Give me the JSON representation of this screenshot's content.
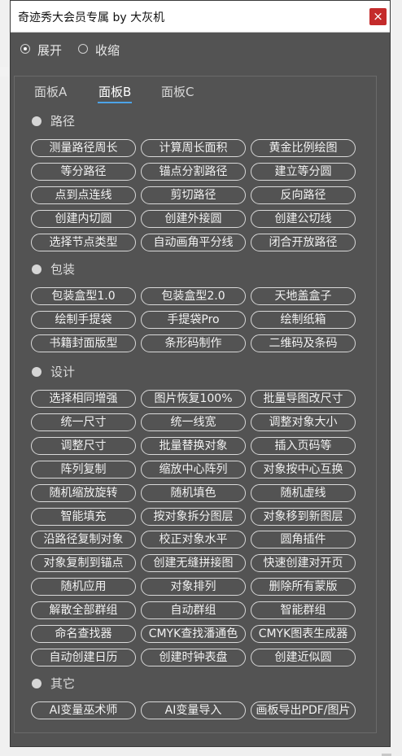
{
  "window": {
    "title": "奇迹秀大会员专属 by 大灰机",
    "close_label": "×"
  },
  "mode": {
    "options": [
      {
        "label": "展开",
        "selected": true
      },
      {
        "label": "收缩",
        "selected": false
      }
    ]
  },
  "tabs": [
    {
      "label": "面板A",
      "active": false
    },
    {
      "label": "面板B",
      "active": true
    },
    {
      "label": "面板C",
      "active": false
    }
  ],
  "sections": [
    {
      "title": "路径",
      "buttons": [
        "测量路径周长",
        "计算周长面积",
        "黄金比例绘图",
        "等分路径",
        "锚点分割路径",
        "建立等分圆",
        "点到点连线",
        "剪切路径",
        "反向路径",
        "创建内切圆",
        "创建外接圆",
        "创建公切线",
        "选择节点类型",
        "自动画角平分线",
        "闭合开放路径"
      ]
    },
    {
      "title": "包装",
      "buttons": [
        "包装盒型1.0",
        "包装盒型2.0",
        "天地盖盒子",
        "绘制手提袋",
        "手提袋Pro",
        "绘制纸箱",
        "书籍封面版型",
        "条形码制作",
        "二维码及条码"
      ]
    },
    {
      "title": "设计",
      "buttons": [
        "选择相同增强",
        "图片恢复100%",
        "批量导图改尺寸",
        "统一尺寸",
        "统一线宽",
        "调整对象大小",
        "调整尺寸",
        "批量替换对象",
        "插入页码等",
        "阵列复制",
        "缩放中心阵列",
        "对象按中心互换",
        "随机缩放旋转",
        "随机填色",
        "随机虚线",
        "智能填充",
        "按对象拆分图层",
        "对象移到新图层",
        "沿路径复制对象",
        "校正对象水平",
        "圆角插件",
        "对象复制到锚点",
        "创建无缝拼接图",
        "快速创建对开页",
        "随机应用",
        "对象排列",
        "删除所有蒙版",
        "解散全部群组",
        "自动群组",
        "智能群组",
        "命名查找器",
        "CMYK查找潘通色",
        "CMYK图表生成器",
        "自动创建日历",
        "创建时钟表盘",
        "创建近似圆"
      ]
    },
    {
      "title": "其它",
      "buttons": [
        "AI变量巫术师",
        "AI变量导入",
        "画板导出PDF/图片"
      ]
    }
  ]
}
